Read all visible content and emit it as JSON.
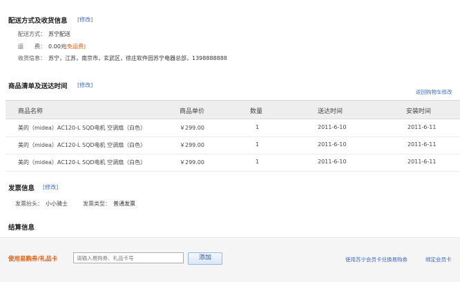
{
  "delivery": {
    "title": "配送方式及收货信息",
    "edit": "[修改]",
    "method_label": "配送方式：",
    "method_value": "苏宁配送",
    "fee_label": "运　　费：",
    "fee_value": "0.00元",
    "fee_note": "(免运费)",
    "address_label": "收货信息：",
    "address_value": "苏宁，江苏，南京市，玄武区，徐庄软件园苏宁电器总部，1398888888"
  },
  "items": {
    "title": "商品清单及送达时间",
    "edit": "[修改]",
    "back_link": "返回购物车修改",
    "columns": [
      "商品名称",
      "商品单价",
      "数量",
      "送达时间",
      "安装时间"
    ],
    "rows": [
      {
        "name": "美的（midea）AC120-L SQD电机 空调扇（白色）",
        "price": "￥299.00",
        "qty": "1",
        "delivery": "2011-6-10",
        "install": "2011-6-11"
      },
      {
        "name": "美的（midea）AC120-L SQD电机 空调扇（白色）",
        "price": "￥299.00",
        "qty": "1",
        "delivery": "2011-6-10",
        "install": "2011-6-11"
      },
      {
        "name": "美的（midea）AC120-L SQD电机 空调扇（白色）",
        "price": "￥299.00",
        "qty": "1",
        "delivery": "2011-6-10",
        "install": "2011-6-11"
      }
    ]
  },
  "invoice": {
    "title": "发票信息",
    "edit": "[修改]",
    "header_label": "发票抬头：",
    "header_value": "小小骑士",
    "type_label": "发票类型：",
    "type_value": "普通发票"
  },
  "settlement": {
    "title": "结算信息"
  },
  "coupon": {
    "label": "使用易购券/礼品卡",
    "placeholder": "请输入易购券、礼品卡号",
    "add_button": "添加",
    "link_exchange": "使用苏宁会员卡兑换易购券",
    "link_bind": "绑定会员卡"
  },
  "colors": {
    "link": "#3a6bc7",
    "accent": "#e8590c"
  }
}
